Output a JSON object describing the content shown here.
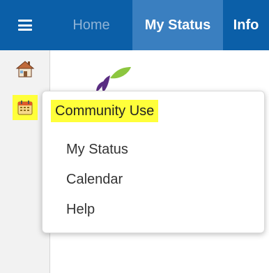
{
  "nav": {
    "menu_icon": "hamburger-icon",
    "tabs": [
      {
        "label": "Home",
        "active": false
      },
      {
        "label": "My Status",
        "active": true
      },
      {
        "label": "Info",
        "active": false
      }
    ]
  },
  "sidebar": {
    "icons": [
      "home-icon",
      "calendar-icon"
    ]
  },
  "dropdown": {
    "title": "Community Use",
    "items": [
      {
        "label": "My Status"
      },
      {
        "label": "Calendar"
      },
      {
        "label": "Help"
      }
    ]
  },
  "colors": {
    "topbar": "#0b5fa8",
    "active_tab": "#3a7fc0",
    "highlight": "#ffff3a"
  }
}
